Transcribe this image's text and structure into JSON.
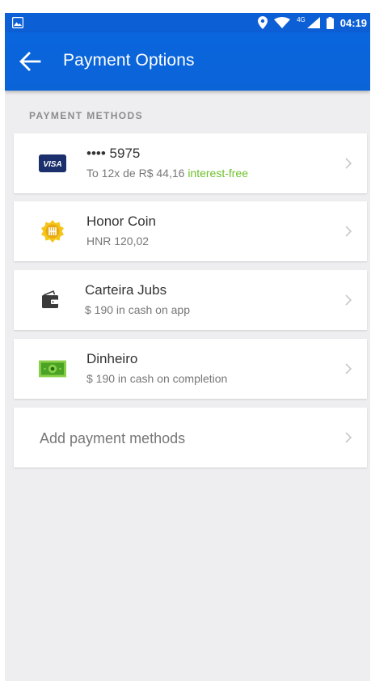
{
  "status_bar": {
    "network_label": "4G",
    "time": "04:19"
  },
  "app_bar": {
    "title": "Payment Options",
    "back_icon": "arrow-left-icon"
  },
  "section": {
    "header": "PAYMENT METHODS"
  },
  "methods": [
    {
      "icon": "visa-card-icon",
      "icon_text": "VISA",
      "title": "•••• 5975",
      "subtitle": "To 12x de R$ 44,16",
      "subtitle_highlight": "interest-free",
      "highlight_color": "#6cc12b"
    },
    {
      "icon": "honor-coin-icon",
      "title": "Honor Coin",
      "subtitle": "HNR 120,02"
    },
    {
      "icon": "wallet-icon",
      "title": "Carteira Jubs",
      "subtitle": "$ 190 in cash on app"
    },
    {
      "icon": "cash-bill-icon",
      "title": "Dinheiro",
      "subtitle": "$ 190 in cash on completion"
    }
  ],
  "add_method": {
    "label": "Add payment methods"
  },
  "colors": {
    "app_bar": "#0b63d8",
    "background": "#eeeef0",
    "accent_green": "#6cc12b"
  }
}
